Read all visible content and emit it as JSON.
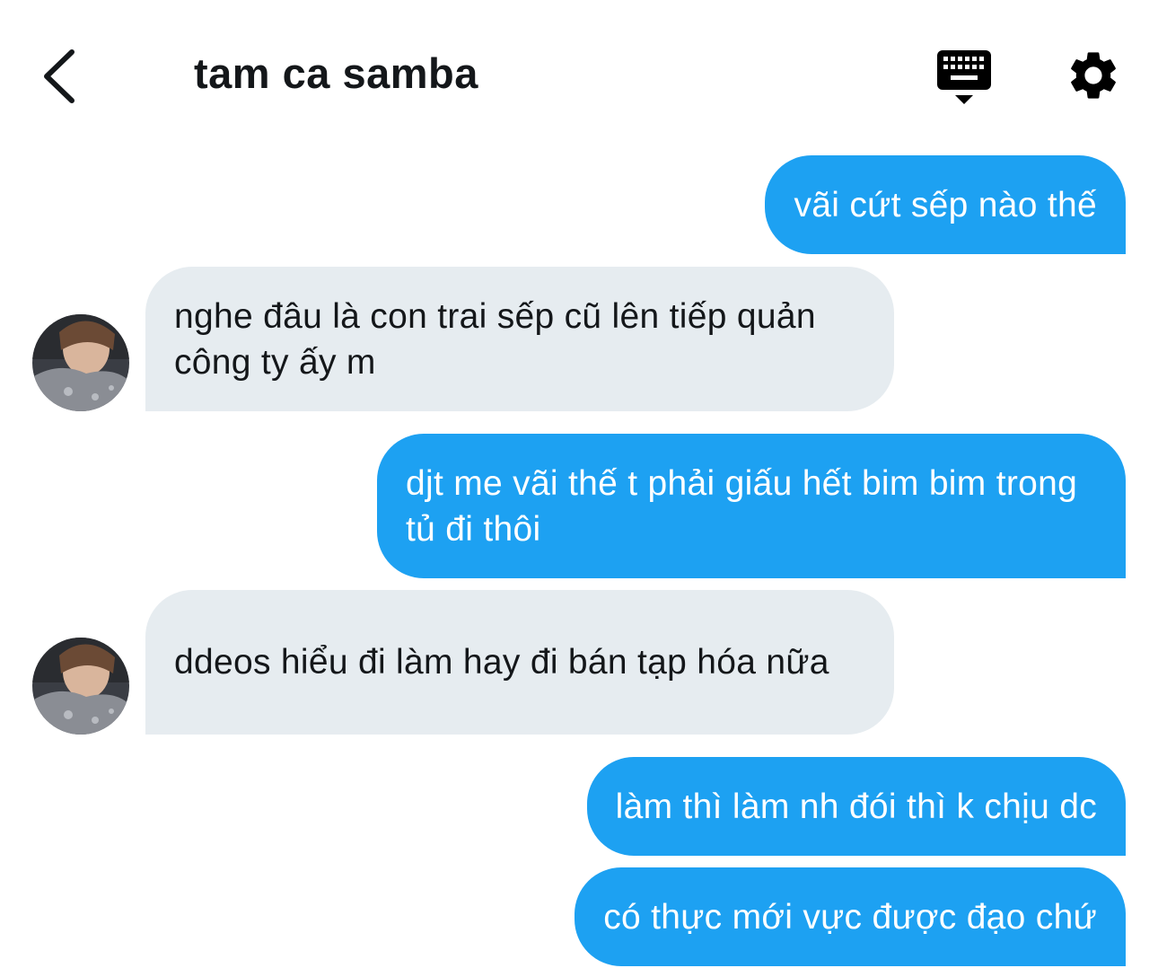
{
  "header": {
    "title": "tam ca samba",
    "back_icon": "chevron-left-icon",
    "keyboard_icon": "keyboard-icon",
    "settings_icon": "gear-icon"
  },
  "colors": {
    "outgoing_bubble": "#1da1f2",
    "incoming_bubble": "#e6ecf0",
    "text_dark": "#14171a"
  },
  "messages": [
    {
      "direction": "outgoing",
      "text": "vãi cứt sếp nào thế"
    },
    {
      "direction": "incoming",
      "text": "nghe đâu là con trai sếp cũ lên tiếp quản công ty ấy m"
    },
    {
      "direction": "outgoing",
      "text": "djt me vãi thế t phải giấu hết bim bim trong tủ đi thôi"
    },
    {
      "direction": "incoming",
      "text": "ddeos hiểu đi làm hay đi bán tạp hóa nữa"
    },
    {
      "direction": "outgoing",
      "text": "làm thì làm nh đói thì k chịu dc"
    },
    {
      "direction": "outgoing",
      "text": "có thực mới vực được đạo chứ"
    }
  ]
}
